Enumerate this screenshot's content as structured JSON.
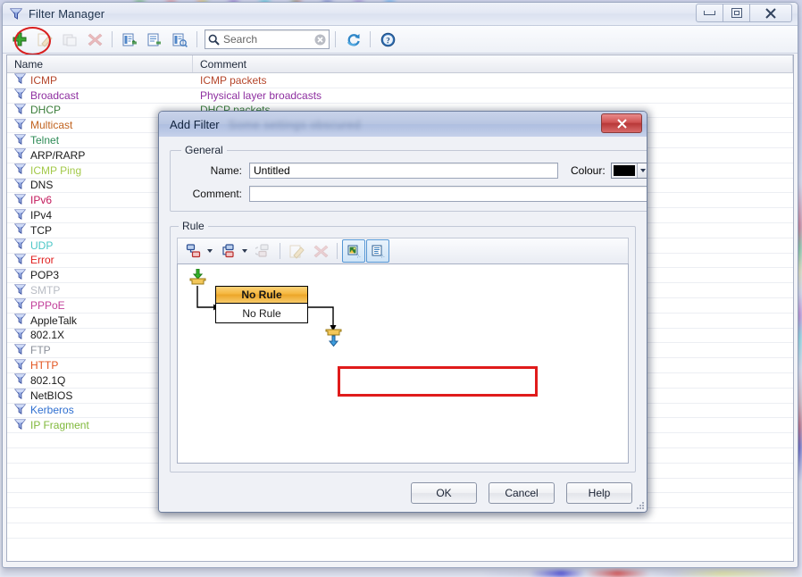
{
  "window": {
    "title": "Filter Manager",
    "icon": "funnel-icon",
    "buttons": {
      "minimize": "minimize-icon",
      "maximize": "maximize-icon",
      "close": "✕"
    }
  },
  "toolbar": {
    "items": [
      {
        "name": "add-filter-button",
        "icon": "plus-icon",
        "enabled": true,
        "highlighted": true
      },
      {
        "name": "edit-filter-button",
        "icon": "pencil-icon",
        "enabled": false
      },
      {
        "name": "duplicate-filter-button",
        "icon": "copy-icon",
        "enabled": false
      },
      {
        "name": "delete-filter-button",
        "icon": "delete-x-icon",
        "enabled": false
      },
      {
        "name": "import-filters-button",
        "icon": "import-icon",
        "enabled": true
      },
      {
        "name": "export-filters-button",
        "icon": "export-icon",
        "enabled": true
      },
      {
        "name": "export-selected-button",
        "icon": "export-selected-icon",
        "enabled": true
      },
      {
        "name": "refresh-button",
        "icon": "refresh-icon",
        "enabled": true
      },
      {
        "name": "help-button",
        "icon": "help-icon",
        "enabled": true
      }
    ],
    "search": {
      "placeholder": "Search",
      "value": "",
      "clear_icon": "clear-circle-icon",
      "search_icon": "magnifier-icon"
    }
  },
  "list": {
    "columns": [
      "Name",
      "Comment"
    ],
    "rows": [
      {
        "name": "ICMP",
        "comment": "ICMP packets",
        "color": "#b5462b",
        "comment_color": "#b5462b"
      },
      {
        "name": "Broadcast",
        "comment": "Physical layer broadcasts",
        "color": "#8e2fa0",
        "comment_color": "#8e2fa0"
      },
      {
        "name": "DHCP",
        "comment": "DHCP packets",
        "color": "#3a7d3a",
        "comment_color": "#3a7d3a"
      },
      {
        "name": "Multicast",
        "comment": "",
        "color": "#c1631f",
        "comment_color": "#c1631f"
      },
      {
        "name": "Telnet",
        "comment": "",
        "color": "#2e8b57",
        "comment_color": "#2e8b57"
      },
      {
        "name": "ARP/RARP",
        "comment": "",
        "color": "#1a1a1a",
        "comment_color": "#1a1a1a"
      },
      {
        "name": "ICMP Ping",
        "comment": "",
        "color": "#a3c94a",
        "comment_color": "#a3c94a"
      },
      {
        "name": "DNS",
        "comment": "",
        "color": "#1a1a1a",
        "comment_color": "#1a1a1a"
      },
      {
        "name": "IPv6",
        "comment": "",
        "color": "#c2185b",
        "comment_color": "#c2185b"
      },
      {
        "name": "IPv4",
        "comment": "",
        "color": "#1a1a1a",
        "comment_color": "#1a1a1a"
      },
      {
        "name": "TCP",
        "comment": "",
        "color": "#1a1a1a",
        "comment_color": "#1a1a1a"
      },
      {
        "name": "UDP",
        "comment": "",
        "color": "#4bc6c6",
        "comment_color": "#4bc6c6"
      },
      {
        "name": "Error",
        "comment": "",
        "color": "#e02020",
        "comment_color": "#e02020"
      },
      {
        "name": "POP3",
        "comment": "",
        "color": "#1a1a1a",
        "comment_color": "#1a1a1a"
      },
      {
        "name": "SMTP",
        "comment": "",
        "color": "#b8bcc4",
        "comment_color": "#b8bcc4"
      },
      {
        "name": "PPPoE",
        "comment": "",
        "color": "#c2409a",
        "comment_color": "#c2409a"
      },
      {
        "name": "AppleTalk",
        "comment": "",
        "color": "#1a1a1a",
        "comment_color": "#1a1a1a"
      },
      {
        "name": "802.1X",
        "comment": "",
        "color": "#1a1a1a",
        "comment_color": "#1a1a1a"
      },
      {
        "name": "FTP",
        "comment": "",
        "color": "#8a8f99",
        "comment_color": "#8a8f99"
      },
      {
        "name": "HTTP",
        "comment": "",
        "color": "#e2541f",
        "comment_color": "#e2541f"
      },
      {
        "name": "802.1Q",
        "comment": "",
        "color": "#1a1a1a",
        "comment_color": "#1a1a1a"
      },
      {
        "name": "NetBIOS",
        "comment": "",
        "color": "#1a1a1a",
        "comment_color": "#1a1a1a"
      },
      {
        "name": "Kerberos",
        "comment": "",
        "color": "#2f6fd0",
        "comment_color": "#2f6fd0"
      },
      {
        "name": "IP Fragment",
        "comment": "",
        "color": "#7fb83a",
        "comment_color": "#7fb83a"
      }
    ],
    "empty_rows": 7
  },
  "dialog": {
    "title": "Add Filter",
    "subtitle_blurred": "Some settings obscured",
    "close_label": "✕",
    "general": {
      "legend": "General",
      "name_label": "Name:",
      "name_value": "Untitled",
      "name_placeholder": "",
      "comment_label": "Comment:",
      "comment_value": "",
      "comment_placeholder": "",
      "colour_label": "Colour:",
      "colour_value": "#000000",
      "colour_arrow": "chevron-down-icon"
    },
    "rule": {
      "legend": "Rule",
      "toolbar_highlighted": true,
      "toolbar_items": [
        {
          "name": "add-and-rule-button",
          "icon": "add-node-icon",
          "enabled": true,
          "has_dropdown": true
        },
        {
          "name": "add-or-rule-button",
          "icon": "add-branch-icon",
          "enabled": true,
          "has_dropdown": true
        },
        {
          "name": "toggle-rule-button",
          "icon": "swap-node-icon",
          "enabled": false,
          "has_dropdown": false
        },
        {
          "name": "edit-rule-button",
          "icon": "pencil-icon",
          "enabled": false,
          "has_dropdown": false
        },
        {
          "name": "delete-rule-button",
          "icon": "delete-x-icon",
          "enabled": false,
          "has_dropdown": false
        },
        {
          "name": "zoom-fit-button",
          "icon": "zoom-fit-icon",
          "enabled": true,
          "has_dropdown": false
        },
        {
          "name": "show-details-button",
          "icon": "show-details-icon",
          "enabled": true,
          "has_dropdown": false
        }
      ],
      "flow": {
        "start_node": "accept-in-icon",
        "end_node": "accept-out-icon",
        "node_title": "No Rule",
        "node_body": "No Rule"
      }
    },
    "buttons": [
      {
        "name": "ok-button",
        "label": "OK"
      },
      {
        "name": "cancel-button",
        "label": "Cancel"
      },
      {
        "name": "help-button",
        "label": "Help"
      }
    ]
  }
}
